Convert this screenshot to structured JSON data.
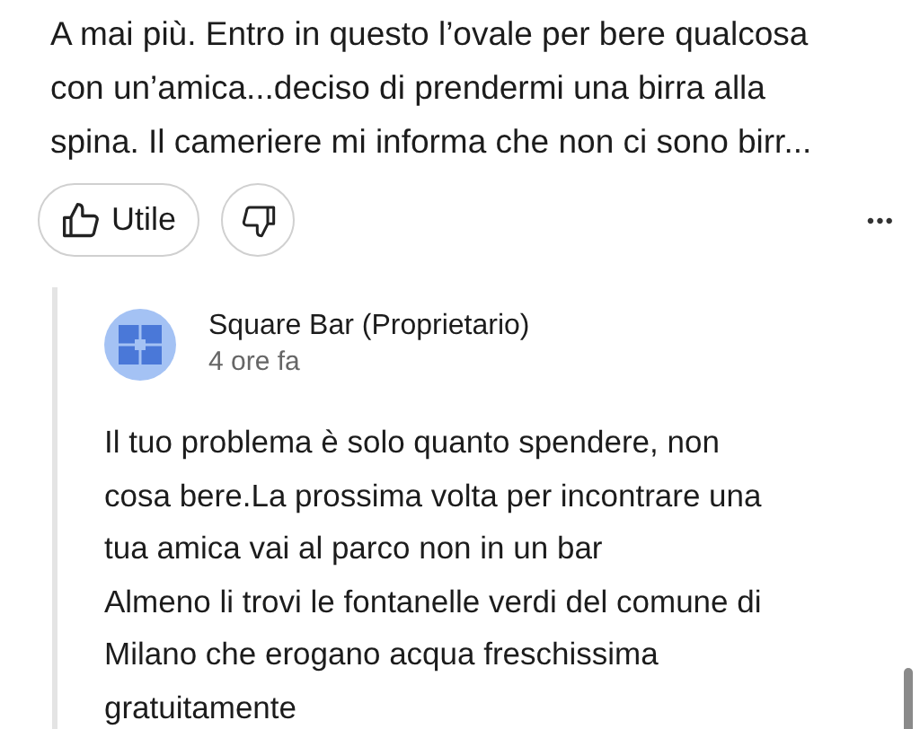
{
  "review": {
    "lines": [
      "A mai più. Entro in questo l’ovale per bere qualcosa",
      "con un’amica...deciso di prendermi una birra alla",
      "spina. Il cameriere mi informa che non ci sono birr..."
    ]
  },
  "actions": {
    "helpful_label": "Utile",
    "more": "•••"
  },
  "reply": {
    "author": "Square Bar (Proprietario)",
    "time": "4 ore fa",
    "paragraphs": [
      [
        "Il tuo problema è solo quanto spendere, non",
        "cosa bere.La prossima volta per incontrare una",
        "tua amica vai al parco non in un bar"
      ],
      [
        "Almeno li trovi le fontanelle verdi del comune di",
        "Milano che erogano acqua freschissima",
        "gratuitamente"
      ]
    ]
  }
}
